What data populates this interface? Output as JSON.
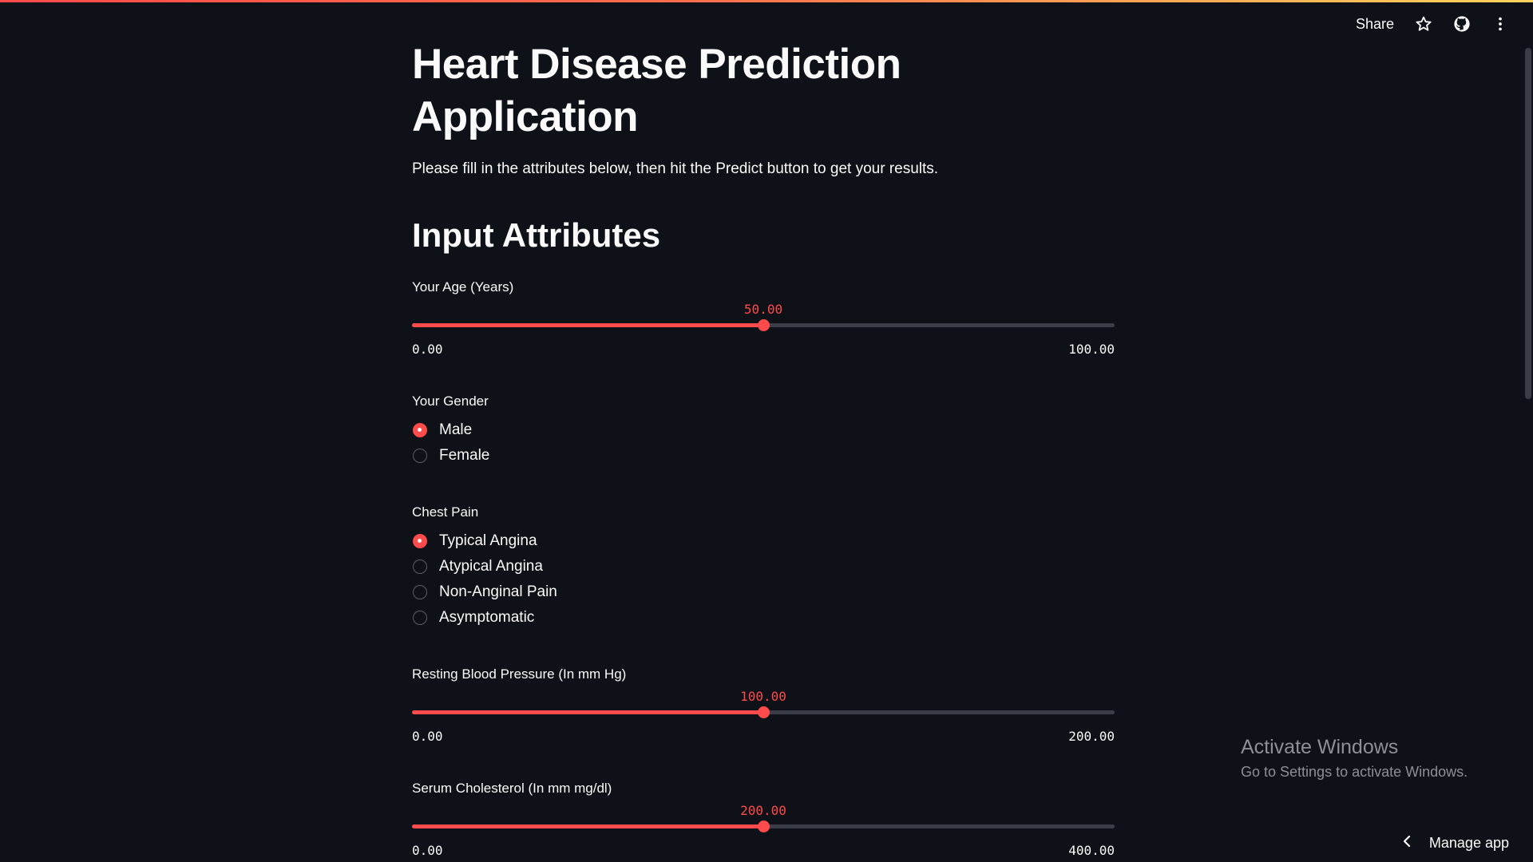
{
  "header": {
    "share_label": "Share",
    "icons": [
      "star-icon",
      "github-icon",
      "more-vert-icon"
    ]
  },
  "main": {
    "title": "Heart Disease Prediction Application",
    "intro": "Please fill in the attributes below, then hit the Predict button to get your results.",
    "section_title": "Input Attributes",
    "age": {
      "label": "Your Age (Years)",
      "value": "50.00",
      "min": "0.00",
      "max": "100.00",
      "fraction": 0.5
    },
    "gender": {
      "label": "Your Gender",
      "options": [
        "Male",
        "Female"
      ],
      "selected": 0
    },
    "chest_pain": {
      "label": "Chest Pain",
      "options": [
        "Typical Angina",
        "Atypical Angina",
        "Non-Anginal Pain",
        "Asymptomatic"
      ],
      "selected": 0
    },
    "blood_pressure": {
      "label": "Resting Blood Pressure (In mm Hg)",
      "value": "100.00",
      "min": "0.00",
      "max": "200.00",
      "fraction": 0.5
    },
    "cholesterol": {
      "label": "Serum Cholesterol (In mm mg/dl)",
      "value": "200.00",
      "min": "0.00",
      "max": "400.00",
      "fraction": 0.5
    }
  },
  "watermark": {
    "line1": "Activate Windows",
    "line2": "Go to Settings to activate Windows."
  },
  "footer": {
    "manage_app_label": "Manage app"
  },
  "colors": {
    "accent": "#ff4b4b",
    "background": "#0e1117",
    "text": "#fafafa"
  }
}
